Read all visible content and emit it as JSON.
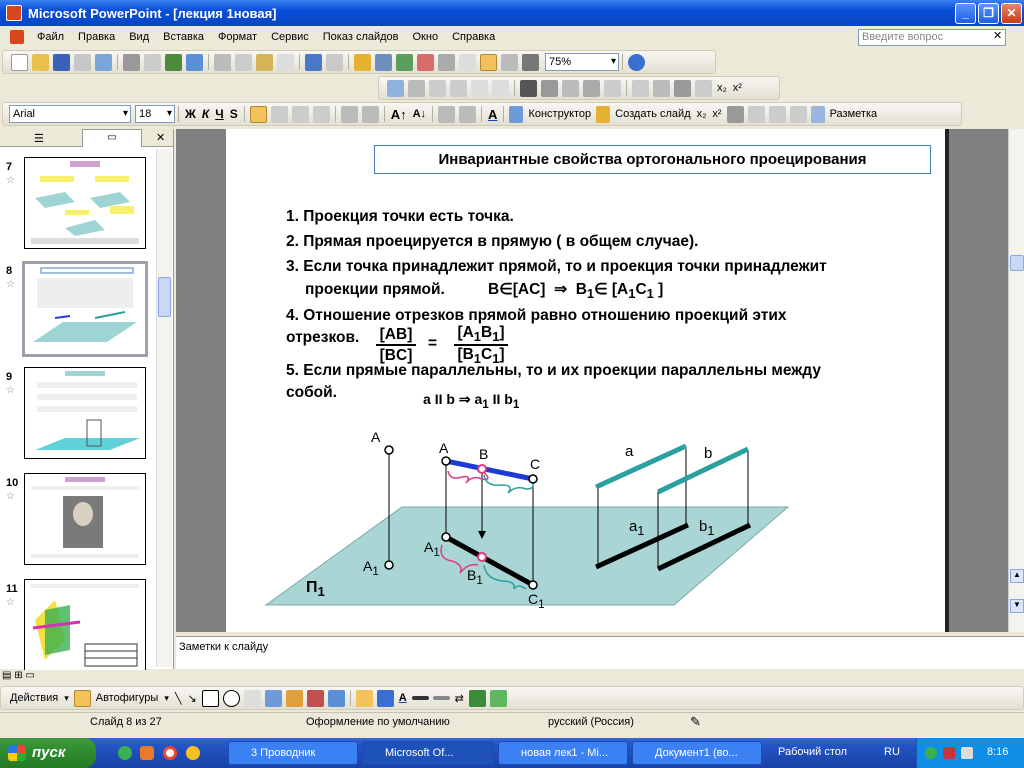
{
  "window": {
    "title": "Microsoft PowerPoint - [лекция 1новая]"
  },
  "menu": [
    "Файл",
    "Правка",
    "Вид",
    "Вставка",
    "Формат",
    "Сервис",
    "Показ слайдов",
    "Окно",
    "Справка"
  ],
  "help": {
    "placeholder": "Введите вопрос"
  },
  "toolbar": {
    "zoom": "75%",
    "font": "Arial",
    "size": "18",
    "designer": "Конструктор",
    "new_slide": "Создать слайд",
    "layout": "Разметка"
  },
  "slides": [
    {
      "num": "7"
    },
    {
      "num": "8"
    },
    {
      "num": "9"
    },
    {
      "num": "10"
    },
    {
      "num": "11"
    }
  ],
  "slide": {
    "title": "Инвариантные свойства ортогонального проецирования",
    "items": [
      "1. Проекция точки есть точка.",
      "2. Прямая проецируется в прямую ( в общем случае).",
      "3. Если точка принадлежит прямой, то и проекция точки принадлежит",
      "проекции прямой.",
      "4. Отношение отрезков прямой равно отношению проекций этих",
      "отрезков.",
      "5. Если прямые параллельны, то и их проекции параллельны между",
      "собой."
    ],
    "formula3": {
      "b": "B",
      "in": "∈",
      "ac": "[AC]",
      "imp": "⇒",
      "b1": "B",
      "sub1": "1",
      "in2": "∈ [A",
      "sub_a": "1",
      "c": "C",
      "sub_c": "1",
      "close": " ]"
    },
    "fraction": {
      "num_left": "[AB]",
      "den_left": "[BC]",
      "eq": "=",
      "num_right_a": "[A",
      "num_right_b": "B",
      "num_right_close": "]",
      "den_right_a": "[B",
      "den_right_c": "C",
      "den_right_close": "]",
      "sub": "1"
    },
    "formula5": {
      "a": "a",
      "par": "II",
      "b": "b",
      "imp": "⇒",
      "a1": "a",
      "b1": "b",
      "sub": "1"
    },
    "labels": {
      "A": "A",
      "A1": "A",
      "A_line": "A",
      "B": "B",
      "C": "C",
      "A1_line": "A",
      "B1": "B",
      "C1": "C",
      "a": "a",
      "b": "b",
      "a1": "a",
      "b1": "b",
      "P1": "П",
      "sub": "1"
    },
    "colors": {
      "plane": "#a9d5d5",
      "blue_segment": "#1f3bd6",
      "pink": "#e0388a",
      "teal": "#2aa0a0",
      "point_pink": "#e0388a"
    }
  },
  "notes": {
    "placeholder": "Заметки к слайду"
  },
  "drawing": {
    "actions": "Действия",
    "autoshapes": "Автофигуры"
  },
  "status": {
    "slide": "Слайд 8 из 27",
    "design": "Оформление по умолчанию",
    "lang": "русский (Россия)"
  },
  "taskbar": {
    "start": "пуск",
    "tasks": [
      "3 Проводник",
      "Microsoft Of...",
      "новая лек1 - Mi...",
      "Документ1 (во...",
      "Рабочий стол"
    ],
    "lang": "RU",
    "time": "8:16"
  }
}
